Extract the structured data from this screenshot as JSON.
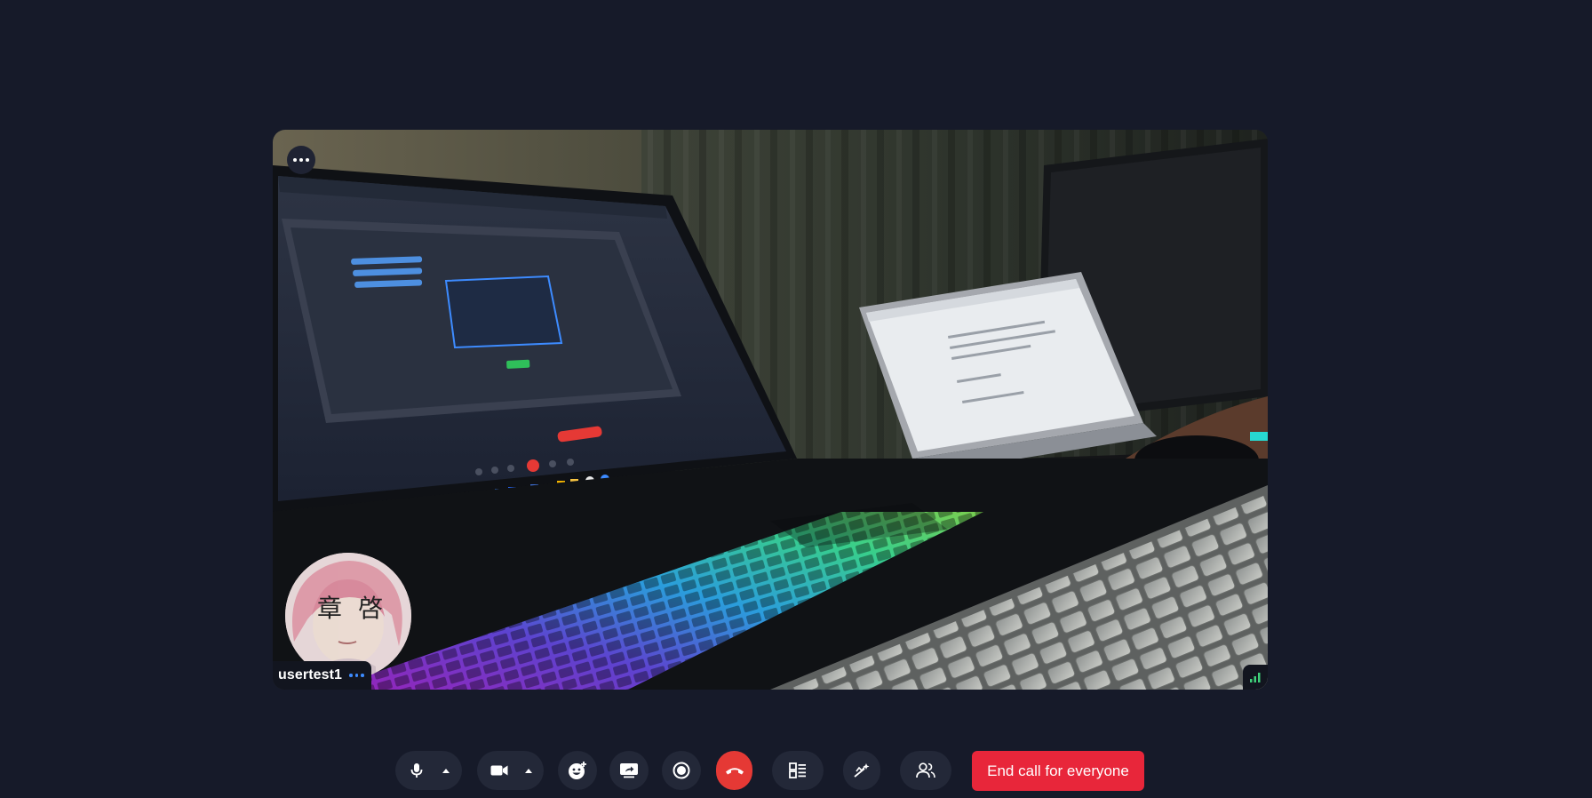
{
  "participant": {
    "name": "usertest1"
  },
  "toolbar": {
    "end_call_everyone_label": "End call for everyone"
  },
  "colors": {
    "background": "#161a29",
    "button_bg": "#232838",
    "end_call_red": "#e53935",
    "end_everyone_red": "#e8263a",
    "accent_blue": "#3d8bff",
    "signal_green": "#3fd17a"
  },
  "icons": {
    "tile_menu": "more-horizontal-icon",
    "participant_options": "more-horizontal-icon",
    "connection": "signal-strength-icon",
    "mic": "microphone-icon",
    "mic_options": "chevron-up-icon",
    "camera": "video-camera-icon",
    "camera_options": "chevron-up-icon",
    "reactions": "emoji-add-icon",
    "screen_share": "screen-share-icon",
    "record": "record-icon",
    "leave": "hang-up-icon",
    "layout": "grid-layout-icon",
    "effects": "sparkle-wand-icon",
    "participants": "people-icon"
  }
}
